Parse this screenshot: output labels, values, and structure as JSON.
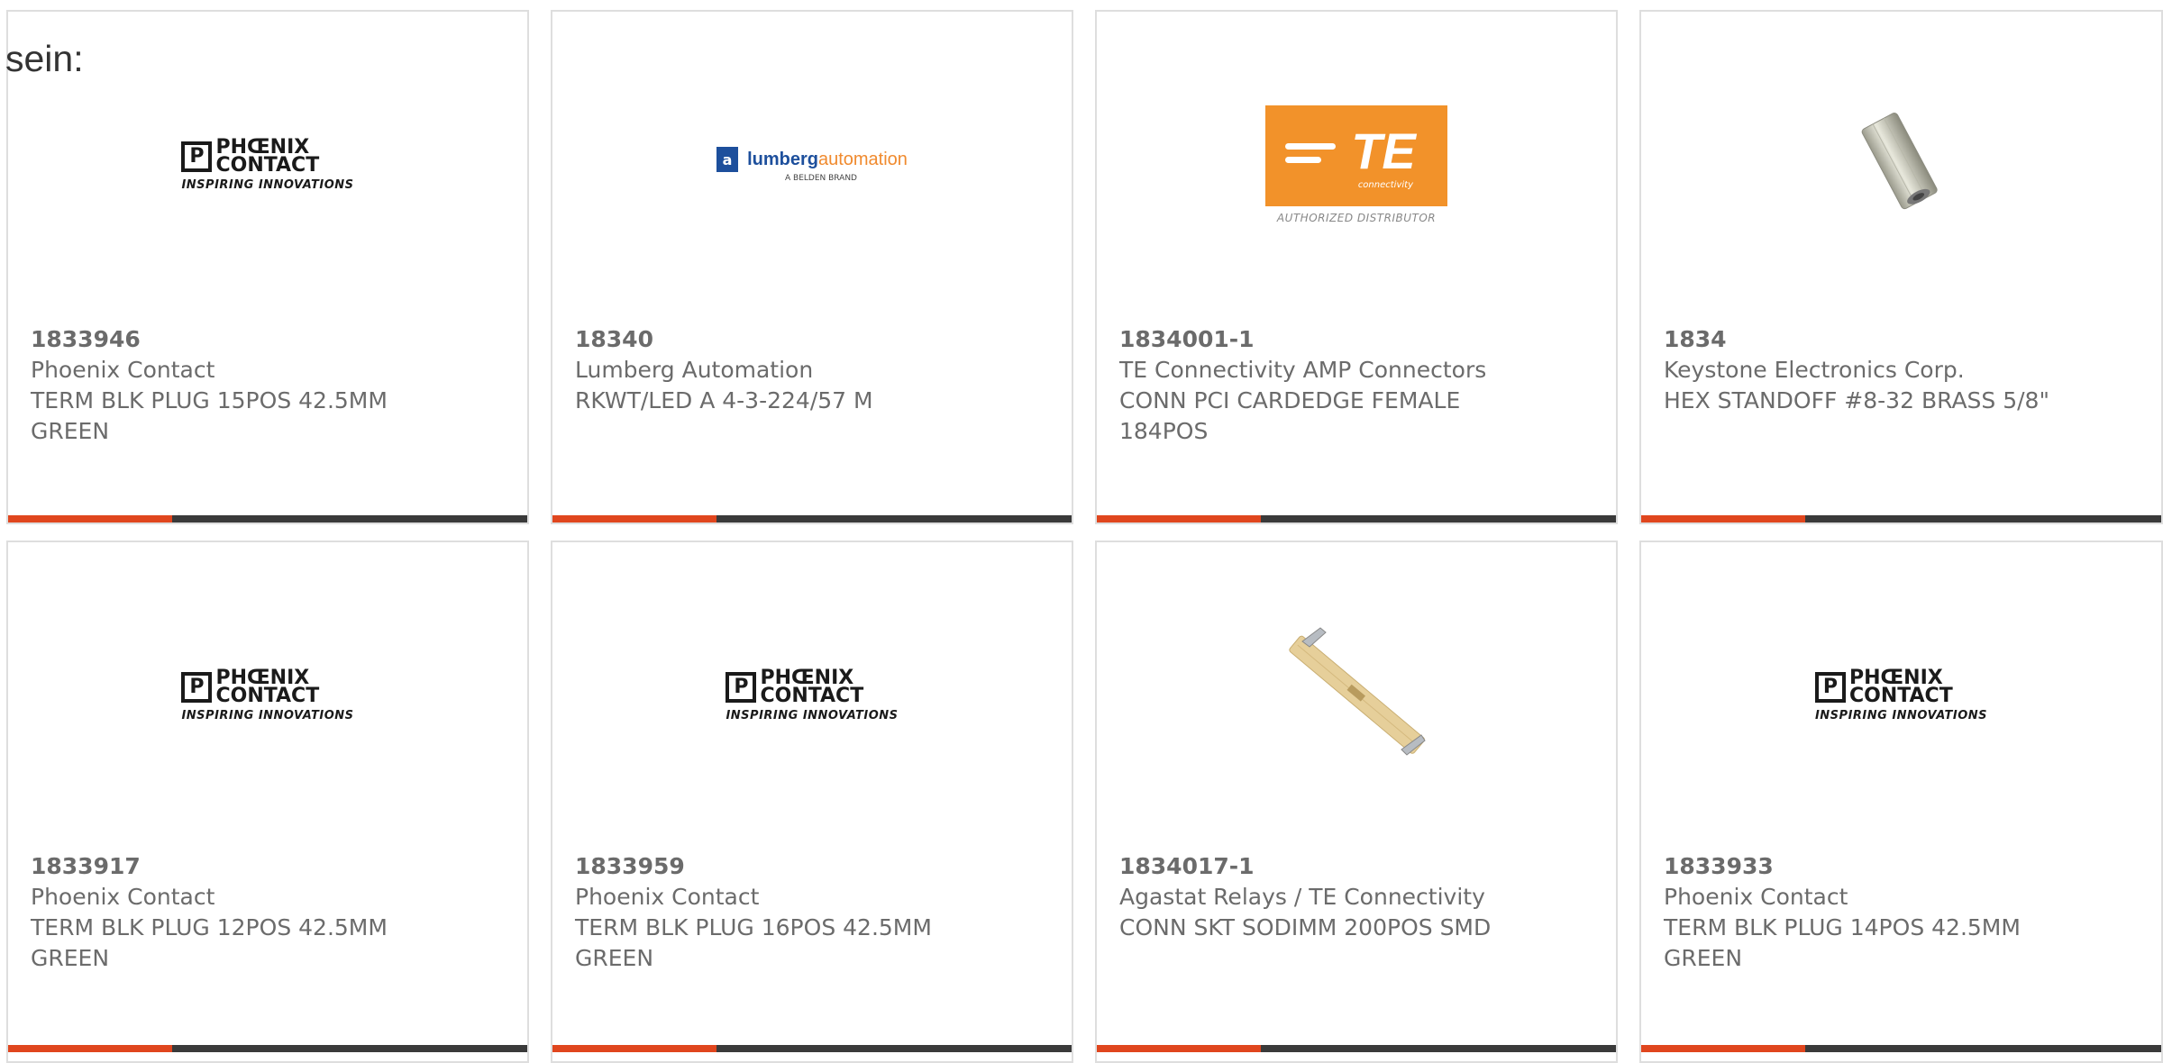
{
  "intro_text": "sein:",
  "colors": {
    "accent": "#e0461e",
    "bar_dark": "#3a3a3a",
    "card_border": "#dedede",
    "text": "#6b6b6b"
  },
  "logos": {
    "phoenix": {
      "mark": "P",
      "line1": "PHŒNIX",
      "line2": "CONTACT",
      "tagline": "INSPIRING INNOVATIONS"
    },
    "lumberg": {
      "mark": "a",
      "word1": "lumberg",
      "word2": "automation",
      "sub": "A BELDEN BRAND"
    },
    "te": {
      "letters": "TE",
      "small": "connectivity",
      "badge": "AUTHORIZED DISTRIBUTOR"
    }
  },
  "products": [
    {
      "part_number": "1833946",
      "manufacturer": "Phoenix Contact",
      "description": "TERM BLK PLUG 15POS 42.5MM GREEN",
      "image": "phoenix-contact-logo"
    },
    {
      "part_number": "18340",
      "manufacturer": "Lumberg Automation",
      "description": "RKWT/LED A 4-3-224/57 M",
      "image": "lumberg-automation-logo"
    },
    {
      "part_number": "1834001-1",
      "manufacturer": "TE Connectivity AMP Connectors",
      "description": "CONN PCI CARDEDGE FEMALE 184POS",
      "image": "te-connectivity-logo"
    },
    {
      "part_number": "1834",
      "manufacturer": "Keystone Electronics Corp.",
      "description": "HEX STANDOFF #8-32 BRASS 5/8\"",
      "image": "hex-standoff-photo"
    },
    {
      "part_number": "1833917",
      "manufacturer": "Phoenix Contact",
      "description": "TERM BLK PLUG 12POS 42.5MM GREEN",
      "image": "phoenix-contact-logo"
    },
    {
      "part_number": "1833959",
      "manufacturer": "Phoenix Contact",
      "description": "TERM BLK PLUG 16POS 42.5MM GREEN",
      "image": "phoenix-contact-logo"
    },
    {
      "part_number": "1834017-1",
      "manufacturer": "Agastat Relays / TE Connectivity",
      "description": "CONN SKT SODIMM 200POS SMD",
      "image": "sodimm-socket-photo"
    },
    {
      "part_number": "1833933",
      "manufacturer": "Phoenix Contact",
      "description": "TERM BLK PLUG 14POS 42.5MM GREEN",
      "image": "phoenix-contact-logo"
    }
  ]
}
